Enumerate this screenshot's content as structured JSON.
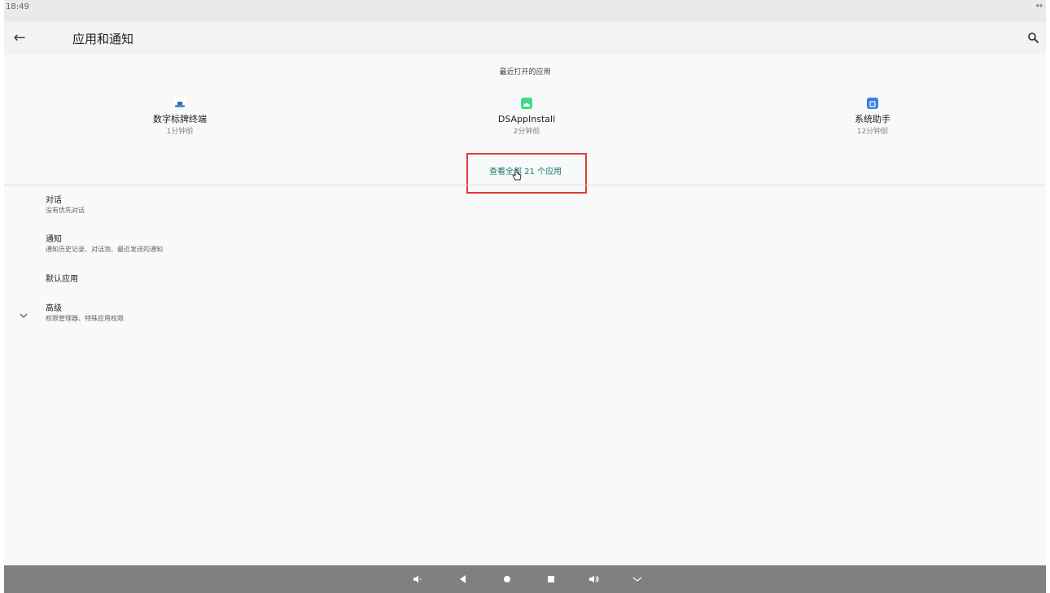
{
  "status_bar": {
    "time": "18:49",
    "right_icon": "↔"
  },
  "app_bar": {
    "title": "应用和通知",
    "back_icon": "arrow-back-icon",
    "search_icon": "search-icon"
  },
  "recent_apps": {
    "title": "最近打开的应用",
    "apps": [
      {
        "name": "数字标牌终端",
        "time": "1分钟前",
        "icon_color": "#4a90c8"
      },
      {
        "name": "DSAppInstall",
        "time": "2分钟前",
        "icon_color": "#3ddc84"
      },
      {
        "name": "系统助手",
        "time": "12分钟前",
        "icon_color": "#3b7fe0"
      }
    ],
    "see_all_label": "查看全部 21 个应用"
  },
  "settings_items": [
    {
      "title": "对话",
      "summary": "没有优先对话"
    },
    {
      "title": "通知",
      "summary": "通知历史记录、对话泡、最近发送的通知"
    },
    {
      "title": "默认应用",
      "summary": ""
    },
    {
      "title": "高级",
      "summary": "权限管理器、特殊应用权限"
    }
  ],
  "colors": {
    "highlight_box": "#e53935",
    "accent": "#1a7a66",
    "nav_bar": "#808080"
  }
}
